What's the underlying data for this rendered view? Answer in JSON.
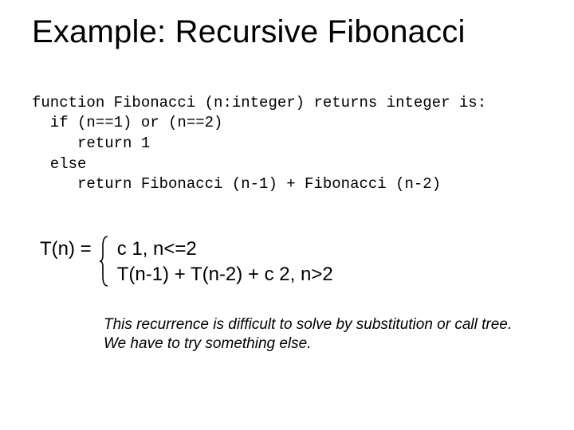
{
  "title": "Example: Recursive Fibonacci",
  "code": {
    "l1": "function Fibonacci (n:integer) returns integer is:",
    "l2": "  if (n==1) or (n==2)",
    "l3": "     return 1",
    "l4": "  else",
    "l5": "     return Fibonacci (n-1) + Fibonacci (n-2)"
  },
  "rec": {
    "lhs": "T(n)  =",
    "case1": "c 1, n<=2",
    "case2": "T(n-1) + T(n-2) + c 2, n>2"
  },
  "note": {
    "l1": "This recurrence is difficult to solve by substitution or call tree.",
    "l2": "We have to try something else."
  }
}
